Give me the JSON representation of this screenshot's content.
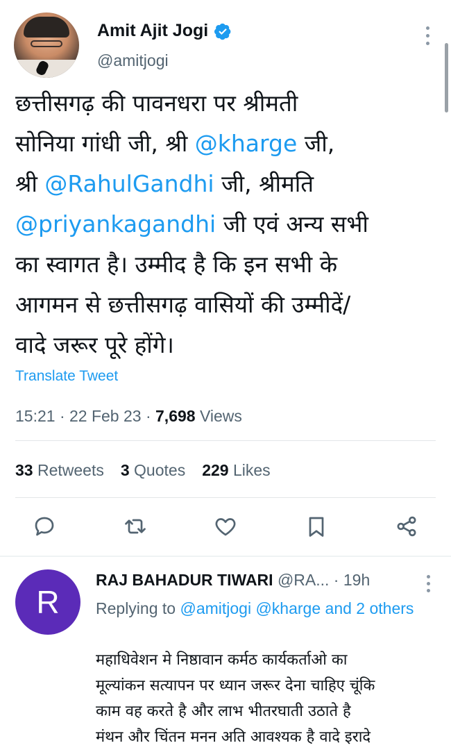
{
  "tweet": {
    "author_name": "Amit Ajit Jogi",
    "author_handle": "@amitjogi",
    "verified_icon": "verified-badge-icon",
    "text": {
      "l1": "छत्तीसगढ़ की पावनधरा पर श्रीमती",
      "l2a": "सोनिया गांधी जी, श्री ",
      "l2m": "@kharge",
      "l2b": " जी,",
      "l3a": "श्री ",
      "l3m": "@RahulGandhi",
      "l3b": " जी, श्रीमति",
      "l4m": "@priyankagandhi",
      "l4b": " जी एवं अन्य सभी",
      "l5": "का स्वागत है। उम्मीद है कि इन सभी के",
      "l6": "आगमन से छत्तीसगढ़ वासियों की उम्मीदें/",
      "l7": "वादे जरूर पूरे होंगे।"
    },
    "translate_label": "Translate Tweet",
    "time": "15:21 · 22 Feb 23 · ",
    "views_count": "7,698",
    "views_label": " Views",
    "retweets_count": "33",
    "retweets_label": " Retweets",
    "quotes_count": "3",
    "quotes_label": " Quotes",
    "likes_count": "229",
    "likes_label": " Likes"
  },
  "actions": [
    "reply-icon",
    "retweet-icon",
    "like-icon",
    "bookmark-icon",
    "share-icon"
  ],
  "reply": {
    "avatar_letter": "R",
    "author_name": "RAJ BAHADUR TIWARI",
    "handle_time": " @RA... · 19h",
    "replying_prefix": "Replying to ",
    "replying_mentions": "@amitjogi @kharge and 2 others",
    "text": {
      "l1": "महाधिवेशन मे निष्ठावान कर्मठ कार्यकर्ताओ का",
      "l2": "मूल्यांकन सत्यापन पर ध्यान जरूर देना चाहिए चूंकि",
      "l3": "काम वह करते है और लाभ भीतरघाती उठाते है",
      "l4": "मंथन और चिंतन मनन अति आवश्यक है वादे इरादे"
    }
  },
  "colors": {
    "link": "#1d9bf0",
    "secondary": "#536471",
    "avatar_bg": "#5b2bb8"
  }
}
